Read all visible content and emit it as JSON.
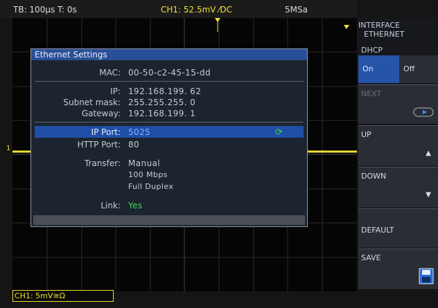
{
  "status": {
    "timebase": "TB: 100µs  T: 0s",
    "ch1": "CH1: 52.5mV ⁄DC",
    "sample_rate": "5MSa"
  },
  "channel": {
    "marker": "1",
    "status_label": "CH1: 5mV≅Ω",
    "trace_color": "#f2e233"
  },
  "dialog": {
    "title": "Ethernet Settings",
    "mac_label": "MAC:",
    "mac_value": "00-50-c2-45-15-dd",
    "ip_label": "IP:",
    "ip_value": "192.168.199. 62",
    "subnet_label": "Subnet mask:",
    "subnet_value": "255.255.255.  0",
    "gateway_label": "Gateway:",
    "gateway_value": "192.168.199.  1",
    "ipport_label": "IP Port:",
    "ipport_value": "5025",
    "httpport_label": "HTTP Port:",
    "httpport_value": "80",
    "transfer_label": "Transfer:",
    "transfer_values": [
      "Manual",
      "100 Mbps",
      "Full Duplex"
    ],
    "link_label": "Link:",
    "link_value": "Yes"
  },
  "menu": {
    "header_line1": "INTERFACE",
    "header_line2": "ETHERNET",
    "dhcp_label": "DHCP",
    "dhcp_on": "On",
    "dhcp_off": "Off",
    "next": "NEXT",
    "up": "UP",
    "down": "DOWN",
    "default": "DEFAULT",
    "save": "SAVE"
  },
  "icons": [
    "refresh-icon",
    "arrow-up-icon",
    "arrow-down-icon",
    "next-arrow-icon",
    "floppy-disk-icon",
    "trigger-marker-icon"
  ]
}
